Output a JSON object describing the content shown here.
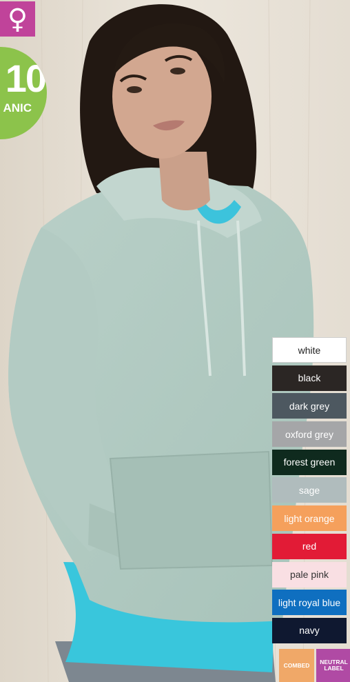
{
  "gender_icon": "female-symbol-icon",
  "gender_symbol": "♀",
  "badge": {
    "number": "10",
    "word": "ANIC",
    "color": "#8cc34b"
  },
  "colors": [
    {
      "name": "white",
      "hex": "#ffffff",
      "text": "#222222"
    },
    {
      "name": "black",
      "hex": "#2b2624",
      "text": "#ffffff"
    },
    {
      "name": "dark grey",
      "hex": "#4d5860",
      "text": "#ffffff"
    },
    {
      "name": "oxford grey",
      "hex": "#a5a6a8",
      "text": "#ffffff"
    },
    {
      "name": "forest green",
      "hex": "#0f2a1e",
      "text": "#ffffff"
    },
    {
      "name": "sage",
      "hex": "#b0bcbd",
      "text": "#ffffff"
    },
    {
      "name": "light orange",
      "hex": "#f5a05c",
      "text": "#ffffff"
    },
    {
      "name": "red",
      "hex": "#e21b36",
      "text": "#ffffff"
    },
    {
      "name": "pale pink",
      "hex": "#f9dfe3",
      "text": "#333333"
    },
    {
      "name": "light royal blue",
      "hex": "#0f6fc0",
      "text": "#ffffff"
    },
    {
      "name": "navy",
      "hex": "#0f1830",
      "text": "#ffffff"
    }
  ],
  "tags": [
    {
      "label": "COMBED",
      "color": "#f0a868"
    },
    {
      "label": "NEUTRAL LABEL",
      "color": "#b04aa4"
    }
  ]
}
